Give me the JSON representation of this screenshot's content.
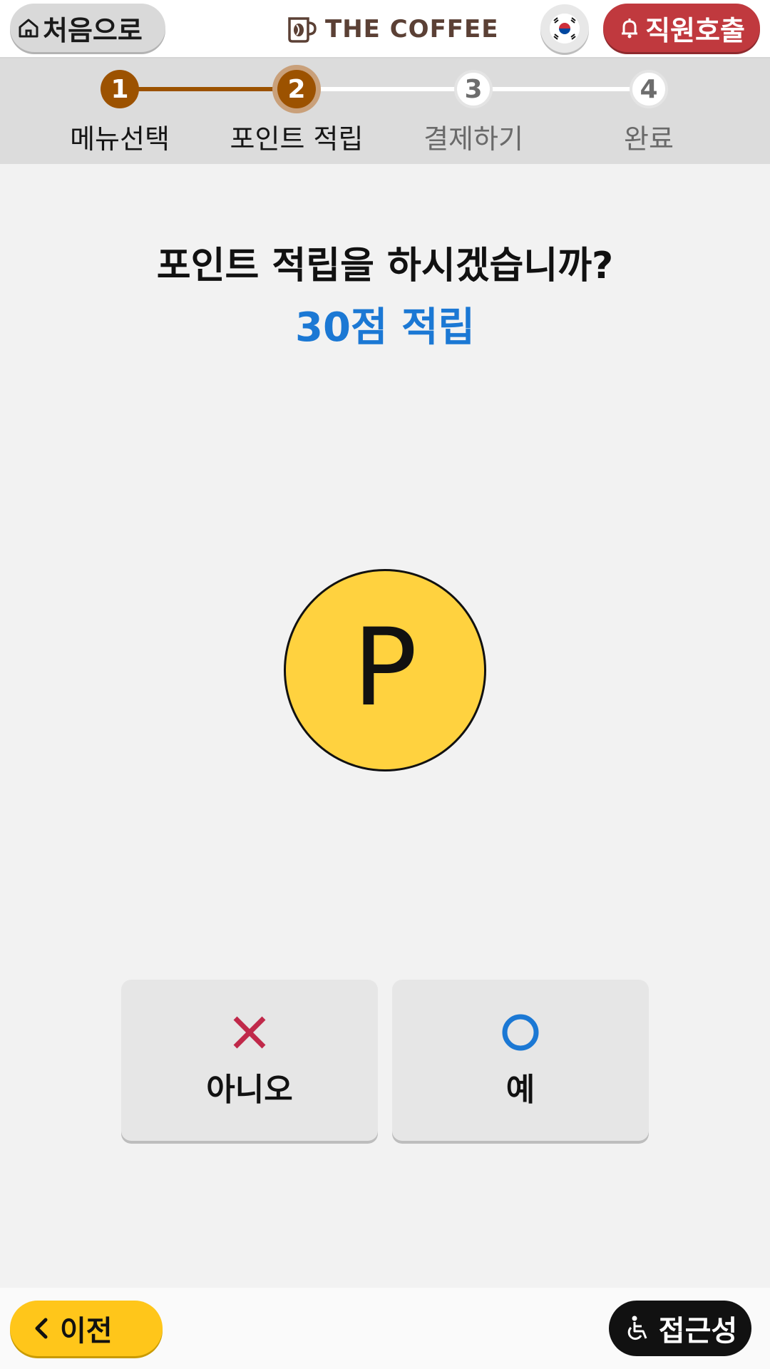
{
  "header": {
    "home_label": "처음으로",
    "home_icon": "home-icon",
    "brand_name": "THE COFFEE",
    "brand_icon": "coffee-cup-icon",
    "language_icon": "korea-flag-icon",
    "call_staff_label": "직원호출",
    "call_staff_icon": "bell-icon",
    "call_staff_color": "#c0393e"
  },
  "steps": [
    {
      "number": "1",
      "label": "메뉴선택",
      "state": "done"
    },
    {
      "number": "2",
      "label": "포인트 적립",
      "state": "current"
    },
    {
      "number": "3",
      "label": "결제하기",
      "state": "todo"
    },
    {
      "number": "4",
      "label": "완료",
      "state": "todo"
    }
  ],
  "progress_color": "#9c5200",
  "main": {
    "question": "포인트 적립을 하시겠습니까?",
    "points_text": "30점 적립",
    "points_color": "#1b78d4",
    "coin_letter": "P",
    "coin_color": "#ffd23f",
    "no_label": "아니오",
    "no_icon": "x-icon",
    "yes_label": "예",
    "yes_icon": "circle-o-icon"
  },
  "footer": {
    "prev_label": "이전",
    "prev_icon": "chevron-left-icon",
    "accessibility_label": "접근성",
    "accessibility_icon": "wheelchair-icon"
  }
}
